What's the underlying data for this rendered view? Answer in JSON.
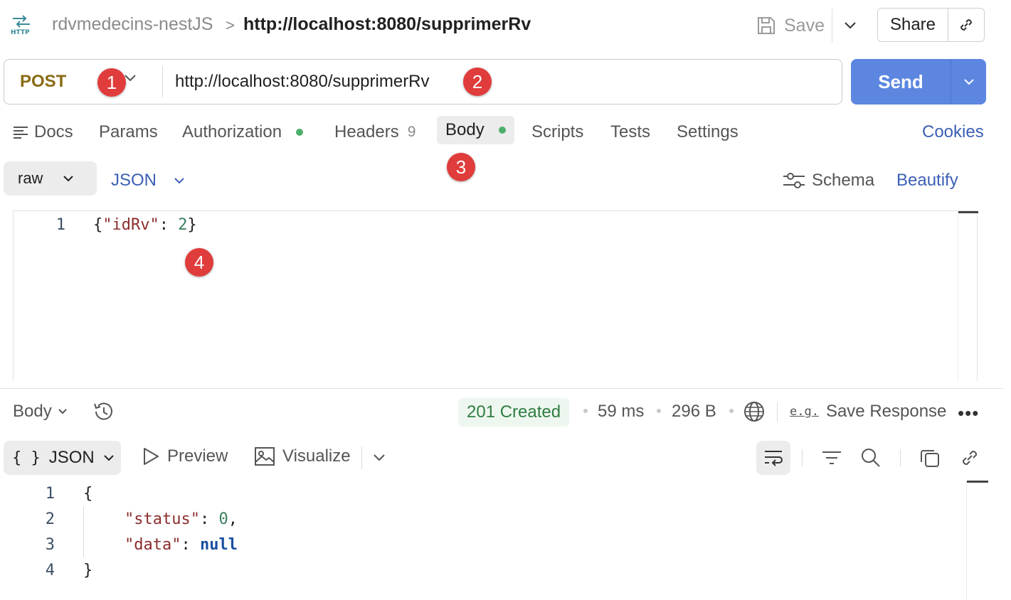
{
  "header": {
    "icon": "http-icon",
    "breadcrumb_parent": "rdvmedecins-nestJS",
    "breadcrumb_sep": ">",
    "breadcrumb_current": "http://localhost:8080/supprimerRv",
    "save_label": "Save",
    "share_label": "Share"
  },
  "request": {
    "method": "POST",
    "url": "http://localhost:8080/supprimerRv",
    "send_label": "Send"
  },
  "markers": [
    "1",
    "2",
    "3",
    "4"
  ],
  "tabs": {
    "docs": "Docs",
    "params": "Params",
    "authorization": "Authorization",
    "headers": "Headers",
    "headers_count": "9",
    "body": "Body",
    "scripts": "Scripts",
    "tests": "Tests",
    "settings": "Settings",
    "cookies": "Cookies"
  },
  "body_options": {
    "mode": "raw",
    "language": "JSON",
    "schema_label": "Schema",
    "beautify_label": "Beautify"
  },
  "request_body": {
    "line_number": "1",
    "open": "{",
    "key": "\"idRv\"",
    "colon": ": ",
    "value": "2",
    "close": "}"
  },
  "response": {
    "body_label": "Body",
    "status": "201 Created",
    "time": "59 ms",
    "size": "296 B",
    "save_response_label": "Save Response",
    "eg_label": "e.g.",
    "more": "•••",
    "format_icon": "{ }",
    "format_label": "JSON",
    "preview_label": "Preview",
    "visualize_label": "Visualize",
    "lines": {
      "n1": "1",
      "n2": "2",
      "n3": "3",
      "n4": "4",
      "open": "{",
      "status_key": "\"status\"",
      "status_value": "0",
      "data_key": "\"data\"",
      "data_value": "null",
      "close": "}"
    }
  },
  "colors": {
    "send": "#5c86e0",
    "method": "#8a6b14",
    "link": "#3b5fb5",
    "status_ok": "#2f7d42",
    "marker": "#e03c3c",
    "dot": "#4caf6a"
  }
}
